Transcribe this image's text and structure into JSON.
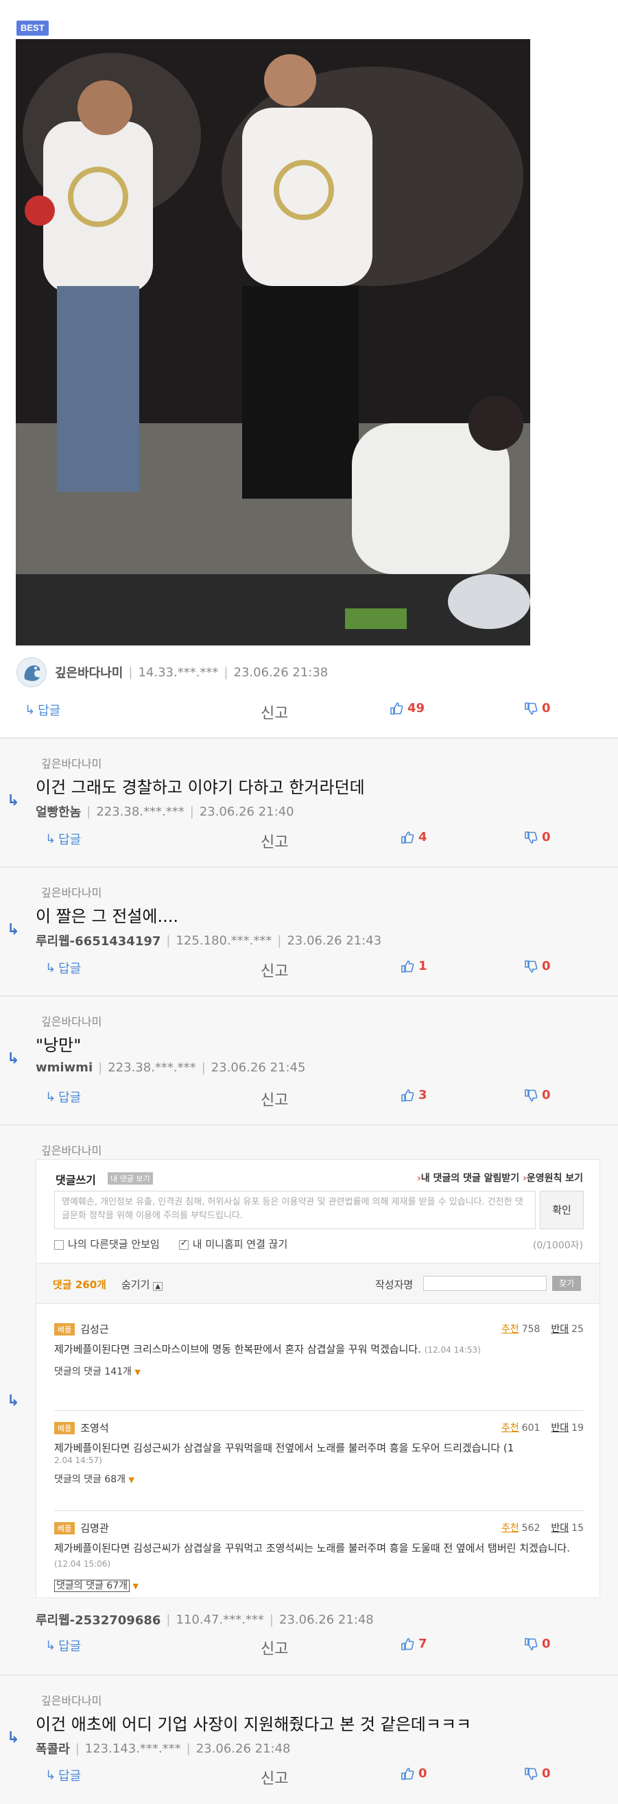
{
  "best_badge": "BEST",
  "main_comment": {
    "nickname": "깊은바다나미",
    "ip": "14.33.***.***",
    "datetime": "23.06.26 21:38",
    "actions": {
      "reply": "답글",
      "report": "신고",
      "likes": "49",
      "dislikes": "0"
    }
  },
  "replies": [
    {
      "parent": "깊은바다나미",
      "text": "이건 그래도 경찰하고 이야기 다하고 한거라던데",
      "nickname": "얼빵한놈",
      "ip": "223.38.***.***",
      "datetime": "23.06.26 21:40",
      "actions": {
        "reply": "답글",
        "report": "신고",
        "likes": "4",
        "dislikes": "0"
      }
    },
    {
      "parent": "깊은바다나미",
      "text": "이 짤은 그 전설에....",
      "nickname": "루리웹-6651434197",
      "ip": "125.180.***.***",
      "datetime": "23.06.26 21:43",
      "actions": {
        "reply": "답글",
        "report": "신고",
        "likes": "1",
        "dislikes": "0"
      }
    },
    {
      "parent": "깊은바다나미",
      "text": "\"낭만\"",
      "nickname": "wmiwmi",
      "ip": "223.38.***.***",
      "datetime": "23.06.26 21:45",
      "actions": {
        "reply": "답글",
        "report": "신고",
        "likes": "3",
        "dislikes": "0"
      }
    },
    {
      "parent": "깊은바다나미",
      "nickname": "루리웹-2532709686",
      "ip": "110.47.***.***",
      "datetime": "23.06.26 21:48",
      "actions": {
        "reply": "답글",
        "report": "신고",
        "likes": "7",
        "dislikes": "0"
      }
    },
    {
      "parent": "깊은바다나미",
      "text": "이건 애초에 어디 기업 사장이 지원해줬다고 본 것 같은데ㅋㅋㅋ",
      "nickname": "폭콜라",
      "ip": "123.143.***.***",
      "datetime": "23.06.26 21:48",
      "actions": {
        "reply": "답글",
        "report": "신고",
        "likes": "0",
        "dislikes": "0"
      }
    }
  ],
  "embedded": {
    "header": "댓글쓰기",
    "header_tag": "내 댓글 보기",
    "link1": "내 댓글의 댓글 알림받기",
    "link2": "운영원칙 보기",
    "notice": "명예훼손, 개인정보 유출, 인격권 침해, 허위사실 유포 등은 이용약관 및 관련법률에 의해 제재를 받을 수 있습니다. 건전한 댓글문화 정착을 위해 이용에 주의를 부탁드립니다.",
    "confirm": "확인",
    "opt1": "나의 다른댓글 안보임",
    "opt2": "내 미니홈피 연결 끊기",
    "counter": "(0/1000자)",
    "count": "댓글 260개",
    "hide": "숨기기",
    "author_label": "작성자명",
    "find": "찾기",
    "tag": "베플",
    "rec_label": "추천",
    "opp_label": "반대",
    "items": [
      {
        "name": "김성근",
        "rec": "758",
        "opp": "25",
        "text": "제가베플이된다면 크리스마스이브에 명동 한복판에서 혼자 삼겹살을 꾸워 먹겠습니다.",
        "time": "(12.04 14:53)",
        "replies": "댓글의 댓글 141개"
      },
      {
        "name": "조영석",
        "rec": "601",
        "opp": "19",
        "text": "제가베플이된다면 김성근씨가 삼겹살을 꾸워먹을때 전옆에서 노래를 불러주며 흥을 도우어 드리겠습니다 (1",
        "time": "2.04 14:57)",
        "replies": "댓글의 댓글 68개"
      },
      {
        "name": "김명관",
        "rec": "562",
        "opp": "15",
        "text": "제가베플이된다면 김성근씨가 삼겹살을 꾸워먹고 조영석씨는 노래를 불러주며 흥을 도울때 전 옆에서 탬버린 치겠습니다.",
        "time": "(12.04 15:06)",
        "replies": "댓글의 댓글 67개"
      }
    ]
  }
}
